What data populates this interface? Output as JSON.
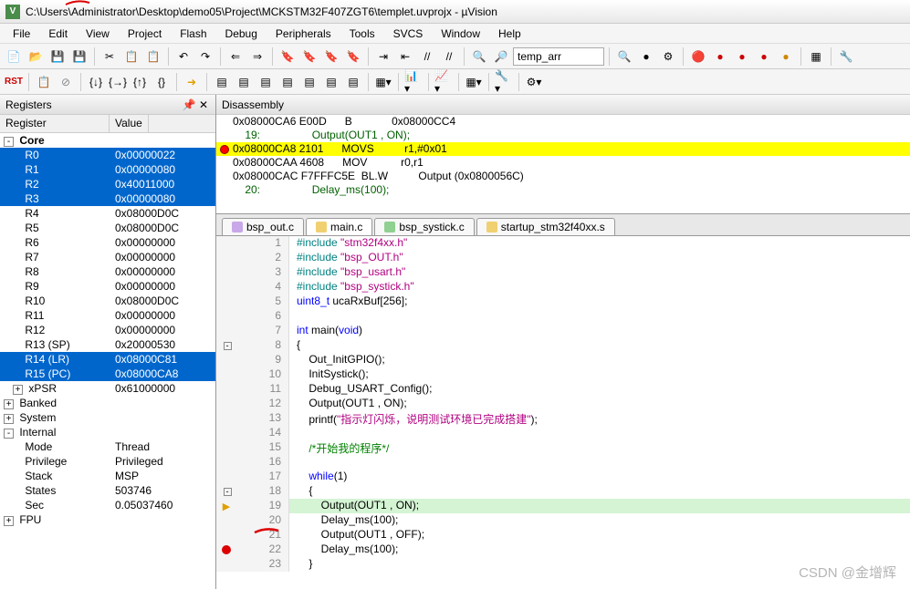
{
  "title": "C:\\Users\\Administrator\\Desktop\\demo05\\Project\\MCKSTM32F407ZGT6\\templet.uvprojx - µVision",
  "app_icon": "V",
  "menu": [
    "File",
    "Edit",
    "View",
    "Project",
    "Flash",
    "Debug",
    "Peripherals",
    "Tools",
    "SVCS",
    "Window",
    "Help"
  ],
  "toolbar_combo": "temp_arr",
  "registers": {
    "title": "Registers",
    "columns": [
      "Register",
      "Value"
    ],
    "core_label": "Core",
    "core": [
      {
        "n": "R0",
        "v": "0x00000022",
        "sel": true
      },
      {
        "n": "R1",
        "v": "0x00000080",
        "sel": true
      },
      {
        "n": "R2",
        "v": "0x40011000",
        "sel": true
      },
      {
        "n": "R3",
        "v": "0x00000080",
        "sel": true
      },
      {
        "n": "R4",
        "v": "0x08000D0C",
        "sel": false
      },
      {
        "n": "R5",
        "v": "0x08000D0C",
        "sel": false
      },
      {
        "n": "R6",
        "v": "0x00000000",
        "sel": false
      },
      {
        "n": "R7",
        "v": "0x00000000",
        "sel": false
      },
      {
        "n": "R8",
        "v": "0x00000000",
        "sel": false
      },
      {
        "n": "R9",
        "v": "0x00000000",
        "sel": false
      },
      {
        "n": "R10",
        "v": "0x08000D0C",
        "sel": false
      },
      {
        "n": "R11",
        "v": "0x00000000",
        "sel": false
      },
      {
        "n": "R12",
        "v": "0x00000000",
        "sel": false
      },
      {
        "n": "R13 (SP)",
        "v": "0x20000530",
        "sel": false
      },
      {
        "n": "R14 (LR)",
        "v": "0x08000C81",
        "sel": true
      },
      {
        "n": "R15 (PC)",
        "v": "0x08000CA8",
        "sel": true
      },
      {
        "n": "xPSR",
        "v": "0x61000000",
        "sel": false,
        "exp": "+"
      }
    ],
    "groups": [
      {
        "n": "Banked",
        "exp": "+"
      },
      {
        "n": "System",
        "exp": "+"
      },
      {
        "n": "Internal",
        "exp": "-",
        "children": [
          {
            "n": "Mode",
            "v": "Thread"
          },
          {
            "n": "Privilege",
            "v": "Privileged"
          },
          {
            "n": "Stack",
            "v": "MSP"
          },
          {
            "n": "States",
            "v": "503746"
          },
          {
            "n": "Sec",
            "v": "0.05037460"
          }
        ]
      },
      {
        "n": "FPU",
        "exp": "+"
      }
    ]
  },
  "disasm": {
    "title": "Disassembly",
    "lines": [
      {
        "addr": "0x08000CA6 E00D      B             0x08000CC4",
        "bp": false
      },
      {
        "src": "    19:                 Output(OUT1 , ON);"
      },
      {
        "addr": "0x08000CA8 2101      MOVS          r1,#0x01",
        "bp": true,
        "hl": true
      },
      {
        "addr": "0x08000CAA 4608      MOV           r0,r1",
        "bp": false
      },
      {
        "addr": "0x08000CAC F7FFFC5E  BL.W          Output (0x0800056C)",
        "bp": false
      },
      {
        "src": "    20:                 Delay_ms(100);"
      }
    ]
  },
  "tabs": [
    {
      "label": "bsp_out.c",
      "color": "#c8a8e8",
      "active": false
    },
    {
      "label": "main.c",
      "color": "#f0d070",
      "active": true
    },
    {
      "label": "bsp_systick.c",
      "color": "#90d090",
      "active": false
    },
    {
      "label": "startup_stm32f40xx.s",
      "color": "#f0d070",
      "active": false
    }
  ],
  "editor": {
    "lines": [
      {
        "n": 1,
        "html": "<span class='pp'>#include</span> <span class='str'>\"stm32f4xx.h\"</span>"
      },
      {
        "n": 2,
        "html": "<span class='pp'>#include</span> <span class='str'>\"bsp_OUT.h\"</span>"
      },
      {
        "n": 3,
        "html": "<span class='pp'>#include</span> <span class='str'>\"bsp_usart.h\"</span>"
      },
      {
        "n": 4,
        "html": "<span class='pp'>#include</span> <span class='str'>\"bsp_systick.h\"</span>"
      },
      {
        "n": 5,
        "html": "<span class='kw'>uint8_t</span> ucaRxBuf[<span class='num'>256</span>];"
      },
      {
        "n": 6,
        "html": ""
      },
      {
        "n": 7,
        "html": "<span class='kw'>int</span> main(<span class='kw'>void</span>)"
      },
      {
        "n": 8,
        "html": "{",
        "fold": "-"
      },
      {
        "n": 9,
        "html": "    Out_InitGPIO();"
      },
      {
        "n": 10,
        "html": "    InitSystick();"
      },
      {
        "n": 11,
        "html": "    Debug_USART_Config();"
      },
      {
        "n": 12,
        "html": "    Output(OUT1 , ON);"
      },
      {
        "n": 13,
        "html": "    printf(<span class='str'>\"指示灯闪烁，说明测试环境已完成搭建\"</span>);"
      },
      {
        "n": 14,
        "html": ""
      },
      {
        "n": 15,
        "html": "    <span class='cmt'>/*开始我的程序*/</span>"
      },
      {
        "n": 16,
        "html": ""
      },
      {
        "n": 17,
        "html": "    <span class='kw'>while</span>(<span class='num'>1</span>)"
      },
      {
        "n": 18,
        "html": "    {",
        "fold": "-"
      },
      {
        "n": 19,
        "html": "        Output(OUT1 , ON);",
        "cur": true,
        "arrow": true
      },
      {
        "n": 20,
        "html": "        Delay_ms(<span class='num'>100</span>);"
      },
      {
        "n": 21,
        "html": "        Output(OUT1 , OFF);"
      },
      {
        "n": 22,
        "html": "        Delay_ms(<span class='num'>100</span>);",
        "bp": true
      },
      {
        "n": 23,
        "html": "    }"
      }
    ]
  },
  "watermark": "CSDN @金增辉"
}
